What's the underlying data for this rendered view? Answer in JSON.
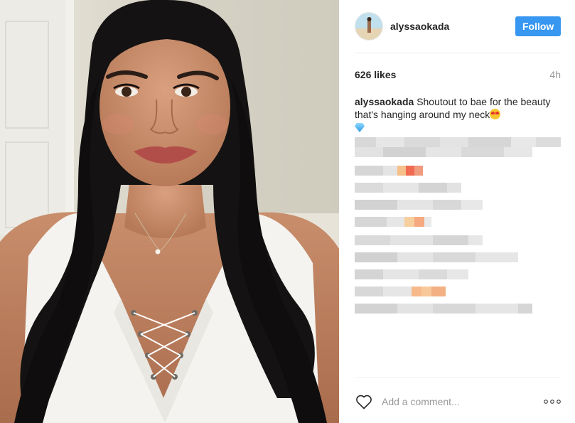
{
  "post": {
    "username": "alyssaokada",
    "follow_label": "Follow",
    "likes": "626 likes",
    "time": "4h",
    "caption_user": "alyssaokada",
    "caption_text": "Shoutout to bae for the beauty that's hanging around my neck",
    "caption_emojis": [
      "heart-eyes-emoji",
      "gem-emoji"
    ],
    "comment_placeholder": "Add a comment...",
    "blurred_comment_count": 10
  },
  "colors": {
    "follow_button": "#3897f0",
    "text": "#262626",
    "muted": "#999999",
    "divider": "#efefef"
  }
}
